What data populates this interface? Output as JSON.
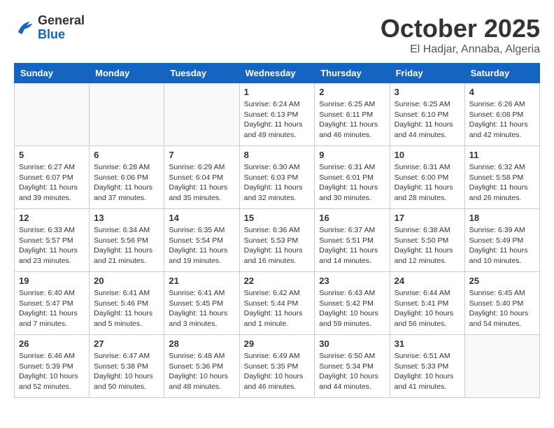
{
  "header": {
    "logo_general": "General",
    "logo_blue": "Blue",
    "month_year": "October 2025",
    "location": "El Hadjar, Annaba, Algeria"
  },
  "days_of_week": [
    "Sunday",
    "Monday",
    "Tuesday",
    "Wednesday",
    "Thursday",
    "Friday",
    "Saturday"
  ],
  "weeks": [
    [
      {
        "day": "",
        "info": ""
      },
      {
        "day": "",
        "info": ""
      },
      {
        "day": "",
        "info": ""
      },
      {
        "day": "1",
        "info": "Sunrise: 6:24 AM\nSunset: 6:13 PM\nDaylight: 11 hours\nand 49 minutes."
      },
      {
        "day": "2",
        "info": "Sunrise: 6:25 AM\nSunset: 6:11 PM\nDaylight: 11 hours\nand 46 minutes."
      },
      {
        "day": "3",
        "info": "Sunrise: 6:25 AM\nSunset: 6:10 PM\nDaylight: 11 hours\nand 44 minutes."
      },
      {
        "day": "4",
        "info": "Sunrise: 6:26 AM\nSunset: 6:08 PM\nDaylight: 11 hours\nand 42 minutes."
      }
    ],
    [
      {
        "day": "5",
        "info": "Sunrise: 6:27 AM\nSunset: 6:07 PM\nDaylight: 11 hours\nand 39 minutes."
      },
      {
        "day": "6",
        "info": "Sunrise: 6:28 AM\nSunset: 6:06 PM\nDaylight: 11 hours\nand 37 minutes."
      },
      {
        "day": "7",
        "info": "Sunrise: 6:29 AM\nSunset: 6:04 PM\nDaylight: 11 hours\nand 35 minutes."
      },
      {
        "day": "8",
        "info": "Sunrise: 6:30 AM\nSunset: 6:03 PM\nDaylight: 11 hours\nand 32 minutes."
      },
      {
        "day": "9",
        "info": "Sunrise: 6:31 AM\nSunset: 6:01 PM\nDaylight: 11 hours\nand 30 minutes."
      },
      {
        "day": "10",
        "info": "Sunrise: 6:31 AM\nSunset: 6:00 PM\nDaylight: 11 hours\nand 28 minutes."
      },
      {
        "day": "11",
        "info": "Sunrise: 6:32 AM\nSunset: 5:58 PM\nDaylight: 11 hours\nand 26 minutes."
      }
    ],
    [
      {
        "day": "12",
        "info": "Sunrise: 6:33 AM\nSunset: 5:57 PM\nDaylight: 11 hours\nand 23 minutes."
      },
      {
        "day": "13",
        "info": "Sunrise: 6:34 AM\nSunset: 5:56 PM\nDaylight: 11 hours\nand 21 minutes."
      },
      {
        "day": "14",
        "info": "Sunrise: 6:35 AM\nSunset: 5:54 PM\nDaylight: 11 hours\nand 19 minutes."
      },
      {
        "day": "15",
        "info": "Sunrise: 6:36 AM\nSunset: 5:53 PM\nDaylight: 11 hours\nand 16 minutes."
      },
      {
        "day": "16",
        "info": "Sunrise: 6:37 AM\nSunset: 5:51 PM\nDaylight: 11 hours\nand 14 minutes."
      },
      {
        "day": "17",
        "info": "Sunrise: 6:38 AM\nSunset: 5:50 PM\nDaylight: 11 hours\nand 12 minutes."
      },
      {
        "day": "18",
        "info": "Sunrise: 6:39 AM\nSunset: 5:49 PM\nDaylight: 11 hours\nand 10 minutes."
      }
    ],
    [
      {
        "day": "19",
        "info": "Sunrise: 6:40 AM\nSunset: 5:47 PM\nDaylight: 11 hours\nand 7 minutes."
      },
      {
        "day": "20",
        "info": "Sunrise: 6:41 AM\nSunset: 5:46 PM\nDaylight: 11 hours\nand 5 minutes."
      },
      {
        "day": "21",
        "info": "Sunrise: 6:41 AM\nSunset: 5:45 PM\nDaylight: 11 hours\nand 3 minutes."
      },
      {
        "day": "22",
        "info": "Sunrise: 6:42 AM\nSunset: 5:44 PM\nDaylight: 11 hours\nand 1 minute."
      },
      {
        "day": "23",
        "info": "Sunrise: 6:43 AM\nSunset: 5:42 PM\nDaylight: 10 hours\nand 59 minutes."
      },
      {
        "day": "24",
        "info": "Sunrise: 6:44 AM\nSunset: 5:41 PM\nDaylight: 10 hours\nand 56 minutes."
      },
      {
        "day": "25",
        "info": "Sunrise: 6:45 AM\nSunset: 5:40 PM\nDaylight: 10 hours\nand 54 minutes."
      }
    ],
    [
      {
        "day": "26",
        "info": "Sunrise: 6:46 AM\nSunset: 5:39 PM\nDaylight: 10 hours\nand 52 minutes."
      },
      {
        "day": "27",
        "info": "Sunrise: 6:47 AM\nSunset: 5:38 PM\nDaylight: 10 hours\nand 50 minutes."
      },
      {
        "day": "28",
        "info": "Sunrise: 6:48 AM\nSunset: 5:36 PM\nDaylight: 10 hours\nand 48 minutes."
      },
      {
        "day": "29",
        "info": "Sunrise: 6:49 AM\nSunset: 5:35 PM\nDaylight: 10 hours\nand 46 minutes."
      },
      {
        "day": "30",
        "info": "Sunrise: 6:50 AM\nSunset: 5:34 PM\nDaylight: 10 hours\nand 44 minutes."
      },
      {
        "day": "31",
        "info": "Sunrise: 6:51 AM\nSunset: 5:33 PM\nDaylight: 10 hours\nand 41 minutes."
      },
      {
        "day": "",
        "info": ""
      }
    ]
  ]
}
